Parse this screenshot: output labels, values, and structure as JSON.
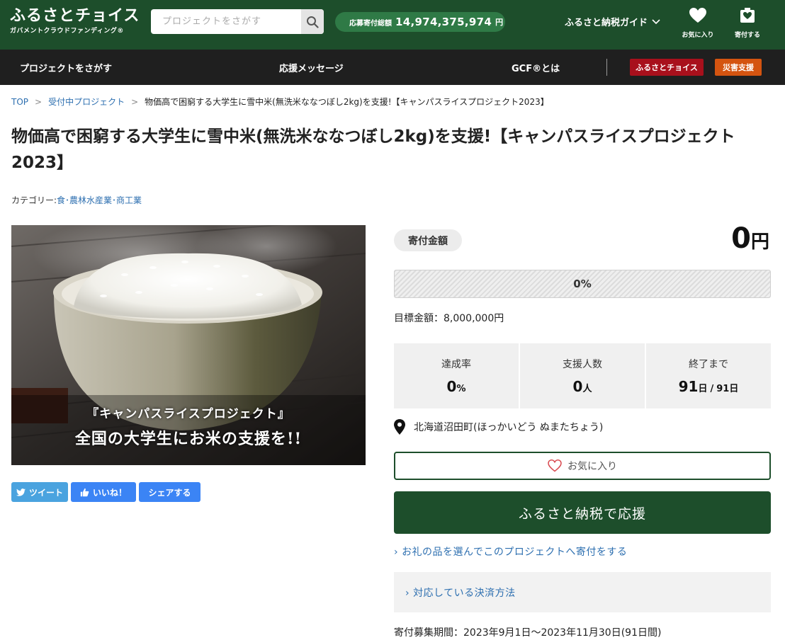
{
  "header": {
    "logo_main": "ふるさとチョイス",
    "logo_sub": "ガバメントクラウドファンディング®",
    "search_placeholder": "プロジェクトをさがす",
    "total_label": "応募寄付総額",
    "total_amount": "14,974,375,974",
    "total_unit": "円",
    "guide_label": "ふるさと納税ガイド",
    "favorites_label": "お気に入り",
    "donate_label": "寄付する"
  },
  "nav": {
    "items": [
      "プロジェクトをさがす",
      "応援メッセージ",
      "GCF®とは"
    ],
    "badge_choice": "ふるさとチョイス",
    "badge_disaster": "災害支援"
  },
  "breadcrumb": {
    "top": "TOP",
    "projects": "受付中プロジェクト",
    "current": "物価高で困窮する大学生に雪中米(無洗米ななつぼし2kg)を支援!【キャンパスライスプロジェクト2023】"
  },
  "project": {
    "title": "物価高で困窮する大学生に雪中米(無洗米ななつぼし2kg)を支援!【キャンパスライスプロジェクト2023】",
    "category_label": "カテゴリー:",
    "category_value": "食･農林水産業･商工業",
    "image_caption_1": "『キャンパスライスプロジェクト』",
    "image_caption_2": "全国の大学生にお米の支援を!!"
  },
  "share": {
    "tweet": "ツイート",
    "like": "いいね！",
    "share": "シェアする"
  },
  "funding": {
    "amount_label": "寄付金額",
    "amount_value": "0",
    "amount_unit": "円",
    "progress_percent": 0,
    "progress_text": "0%",
    "goal_text": "目標金額：8,000,000円",
    "stats": [
      {
        "label": "達成率",
        "value": "0",
        "unit": "%"
      },
      {
        "label": "支援人数",
        "value": "0",
        "unit": "人"
      },
      {
        "label": "終了まで",
        "value": "91",
        "unit": "日",
        "total": "91",
        "total_unit": "日"
      }
    ],
    "location": "北海道沼田町(ほっかいどう ぬまたちょう)",
    "favorite_button": "お気に入り",
    "support_button": "ふるさと納税で応援",
    "gift_link": "お礼の品を選んでこのプロジェクトへ寄付をする",
    "payment_link": "対応している決済方法",
    "period_text": "寄付募集期間：2023年9月1日〜2023年11月30日(91日間)"
  },
  "colors": {
    "brand_green": "#1d4e2b",
    "pill_green": "#2f7a46",
    "nav_dark": "#1f1f1f",
    "badge_red": "#a8101c",
    "badge_orange": "#d45410",
    "link_blue": "#2d6fb0",
    "twitter_blue": "#4aa3df",
    "facebook_blue": "#3b84f5"
  },
  "icons": [
    "search-icon",
    "chevron-down-icon",
    "heart-icon",
    "donate-box-icon",
    "twitter-bird-icon",
    "thumbs-up-icon",
    "map-pin-icon",
    "heart-outline-icon",
    "chevron-right-icon"
  ]
}
